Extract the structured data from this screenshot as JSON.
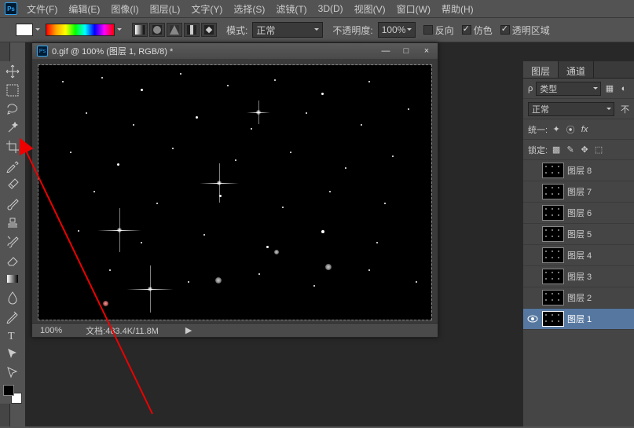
{
  "menu": {
    "items": [
      "文件(F)",
      "编辑(E)",
      "图像(I)",
      "图层(L)",
      "文字(Y)",
      "选择(S)",
      "滤镜(T)",
      "3D(D)",
      "视图(V)",
      "窗口(W)",
      "帮助(H)"
    ]
  },
  "options": {
    "mode_label": "模式:",
    "mode_value": "正常",
    "opacity_label": "不透明度:",
    "opacity_value": "100%",
    "chk_reverse": "反向",
    "chk_dither": "仿色",
    "chk_transparency": "透明区域"
  },
  "document": {
    "title": "0.gif @ 100% (图层 1, RGB/8) *",
    "zoom": "100%",
    "docsize": "文档:483.4K/11.8M"
  },
  "panel": {
    "tab1": "图层",
    "tab2": "通道",
    "filter": "类型",
    "blend": "正常",
    "opacity_label": "不",
    "unify": "统一:",
    "lock": "锁定:",
    "layers": [
      "图层 8",
      "图层 7",
      "图层 6",
      "图层 5",
      "图层 4",
      "图层 3",
      "图层 2",
      "图层 1"
    ]
  },
  "chart_data": null
}
